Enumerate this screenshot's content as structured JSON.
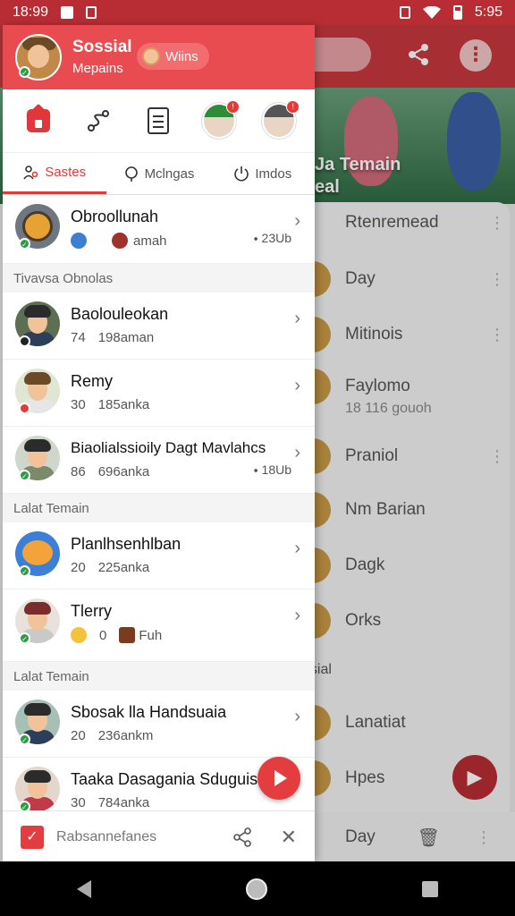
{
  "status_bar": {
    "time": "18:99",
    "clock_right": "5:95"
  },
  "background": {
    "banner_title": "Ja Temain",
    "banner_sub": "eal",
    "rows": [
      {
        "label": "Rtenremead"
      },
      {
        "label": "Day"
      },
      {
        "label": "Mitinois"
      },
      {
        "label": "Faylomo",
        "meta": "18    116 gouoh"
      },
      {
        "label": "Praniol"
      },
      {
        "label": "Nm Barian"
      },
      {
        "label": "Dagk"
      },
      {
        "label": "Orks"
      },
      {
        "label": "nssial"
      },
      {
        "label": "Lanatiat"
      },
      {
        "label": "Hpes"
      },
      {
        "label": "Day"
      }
    ]
  },
  "drawer": {
    "header": {
      "title": "Sossial",
      "subtitle": "Mepains",
      "pill_label": "Wiins"
    },
    "tabs": [
      {
        "label": "Sastes",
        "active": true
      },
      {
        "label": "Mclngas"
      },
      {
        "label": "Imdos"
      }
    ],
    "top_item": {
      "name": "Obroollunah",
      "meta_label": "amah",
      "right": "23Ub"
    },
    "sections": [
      {
        "title": "Tivavsa Obnolas",
        "items": [
          {
            "name": "Baolouleokan",
            "count": "74",
            "meta": "198aman"
          },
          {
            "name": "Remy",
            "count": "30",
            "meta": "185anka"
          },
          {
            "name": "Biaolialssioily Dagt Mavlahcs",
            "count": "86",
            "meta": "696anka",
            "right": "18Ub"
          }
        ]
      },
      {
        "title": "Lalat Temain",
        "items": [
          {
            "name": "Planlhsenhlban",
            "count": "20",
            "meta": "225anka"
          },
          {
            "name": "Tlerry",
            "count": "0",
            "meta": "Fuh"
          }
        ]
      },
      {
        "title": "Lalat Temain",
        "items": [
          {
            "name": "Sbosak lla Handsuaia",
            "count": "20",
            "meta": "236ankm"
          },
          {
            "name": "Taaka Dasagania Sduguis",
            "count": "30",
            "meta": "784anka"
          }
        ]
      }
    ],
    "bottom_bar": {
      "label": "Rabsannefanes"
    }
  },
  "colors": {
    "accent": "#e84c50",
    "status_bar": "#b82d33",
    "online": "#2c9c43"
  }
}
